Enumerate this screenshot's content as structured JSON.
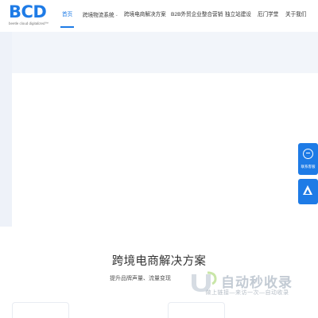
{
  "logo": {
    "main": "BCD",
    "tagline": "beetle cloud digitalized™"
  },
  "nav": {
    "items": [
      {
        "label": "首页",
        "active": true
      },
      {
        "label": "跨境物流系统",
        "active": false,
        "has_dropdown": true
      },
      {
        "label": "跨境电商解决方案",
        "active": false
      },
      {
        "label": "B2B外贸企业整合营销",
        "active": false
      },
      {
        "label": "独立站建设",
        "active": false
      },
      {
        "label": "厄门学堂",
        "active": false
      },
      {
        "label": "关于我们",
        "active": false
      }
    ]
  },
  "float": {
    "service_label": "联系客服"
  },
  "section": {
    "title": "跨境电商解决方案",
    "subtitle": "提升品牌声量、流量变现"
  },
  "watermark": {
    "title": "自动秒收录",
    "subtitle": "做上链接—来访一次—自动收录"
  },
  "colors": {
    "accent": "#1e7be6",
    "hero_band": "#f2f5fa",
    "watermark": "#c3cbd4"
  }
}
